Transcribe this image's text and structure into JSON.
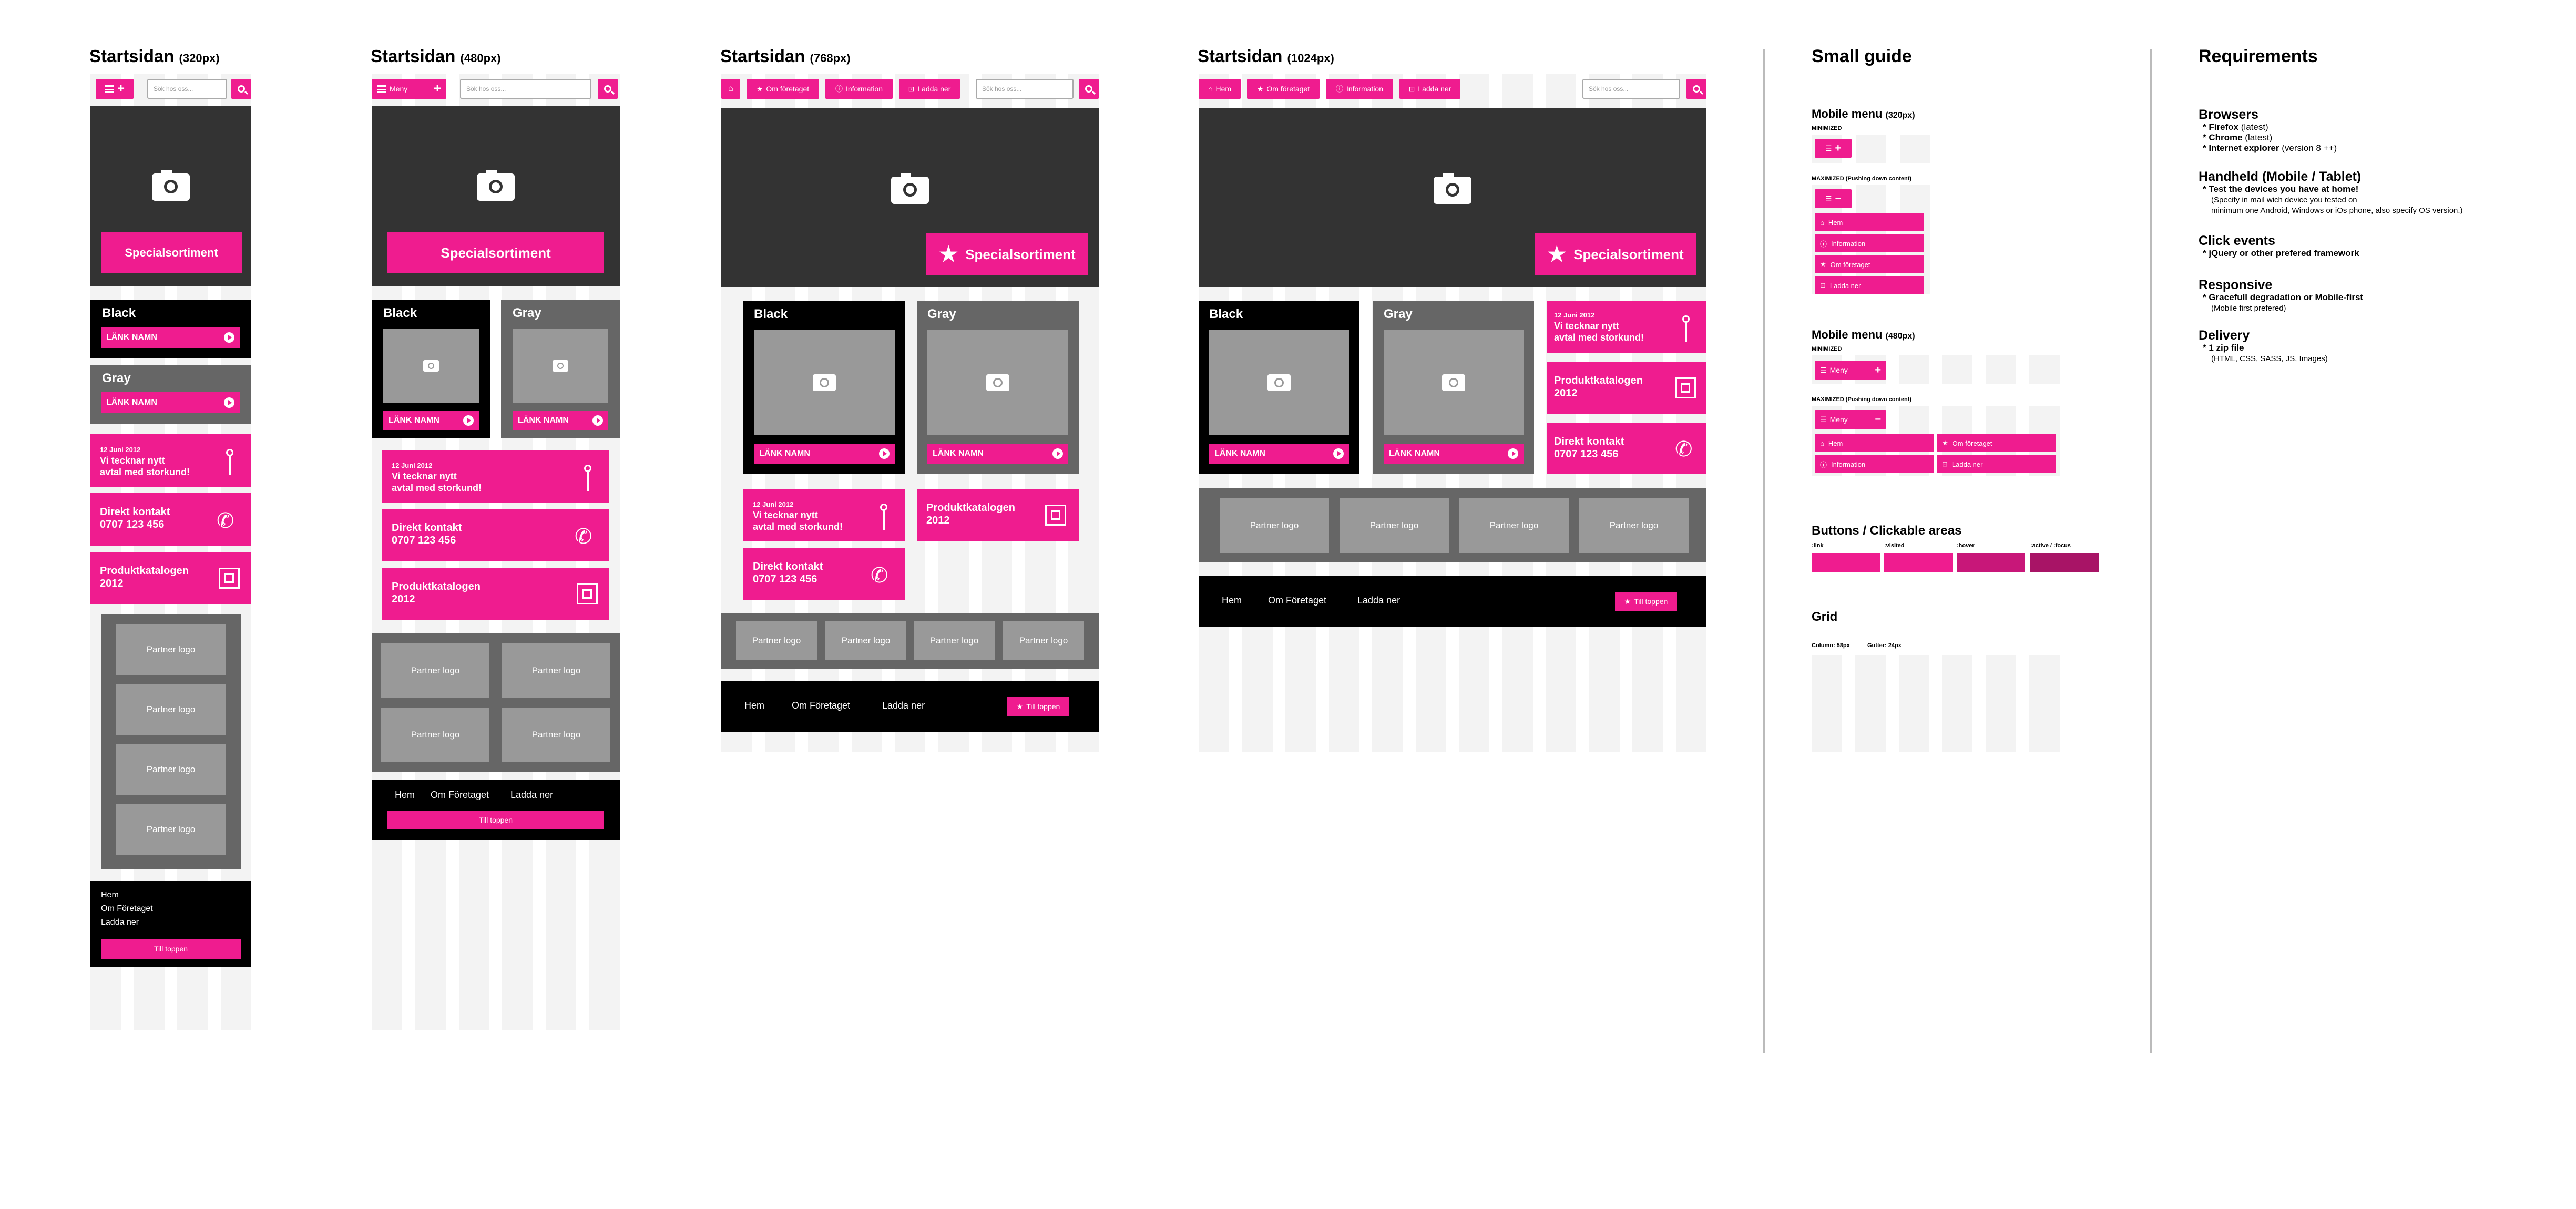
{
  "layouts": {
    "l320": {
      "title": "Startsidan",
      "size": "(320px)"
    },
    "l480": {
      "title": "Startsidan",
      "size": "(480px)"
    },
    "l768": {
      "title": "Startsidan",
      "size": "(768px)"
    },
    "l1024": {
      "title": "Startsidan",
      "size": "(1024px)"
    }
  },
  "common": {
    "search_placeholder": "Sök hos oss...",
    "menu_label": "Meny",
    "special": "Specialsortiment",
    "card_black": "Black",
    "card_gray": "Gray",
    "link_name": "LÄNK NAMN",
    "news_date": "12 Juni 2012",
    "news_text": "Vi tecknar nytt\navtal med storkund!",
    "contact_text": "Direkt kontakt\n0707 123 456",
    "catalog_text": "Produktkatalogen\n2012",
    "partner_logo": "Partner logo",
    "to_top": "Till toppen"
  },
  "nav": [
    "Hem",
    "Om företaget",
    "Information",
    "Ladda ner"
  ],
  "footer_links": {
    "l320": [
      "Hem",
      "Om Företaget",
      "Ladda ner"
    ],
    "wide": [
      "Hem",
      "Om Företaget",
      "Ladda ner"
    ]
  },
  "guide": {
    "title": "Small guide",
    "mobile320": "Mobile menu",
    "mobile320_size": "(320px)",
    "mobile480": "Mobile menu",
    "mobile480_size": "(480px)",
    "minimized": "MINIMIZED",
    "maximized": "MAXIMIZED (Pushing down content)",
    "menu_items": [
      "Hem",
      "Information",
      "Om företaget",
      "Ladda ner"
    ],
    "buttons_title": "Buttons / Clickable areas",
    "btn_states": [
      ":link",
      ":visited",
      ":hover",
      ":active / :focus"
    ],
    "btn_colors": [
      "#ef1c8f",
      "#ef1c8f",
      "#c81779",
      "#a81466"
    ],
    "grid_title": "Grid",
    "grid_note": [
      "Column: 58px",
      "Gutter: 24px"
    ]
  },
  "requirements": {
    "title": "Requirements",
    "browsers_t": "Browsers",
    "browsers": [
      [
        "* Firefox",
        " (latest)"
      ],
      [
        "* Chrome",
        " (latest)"
      ],
      [
        "* Internet explorer",
        " (version 8 ++)"
      ]
    ],
    "handheld_t": "Handheld (Mobile / Tablet)",
    "handheld": [
      "* Test the devices you have at home!",
      "(Specify in mail wich device you tested on",
      "minimum one Android, Windows or iOs phone, also specify OS version.)"
    ],
    "click_t": "Click events",
    "click": "* jQuery or other prefered framework",
    "responsive_t": "Responsive",
    "responsive": [
      "* Gracefull degradation or Mobile-first",
      "(Mobile first prefered)"
    ],
    "delivery_t": "Delivery",
    "delivery": [
      "* 1 zip file",
      "(HTML, CSS, SASS, JS, Images)"
    ]
  }
}
